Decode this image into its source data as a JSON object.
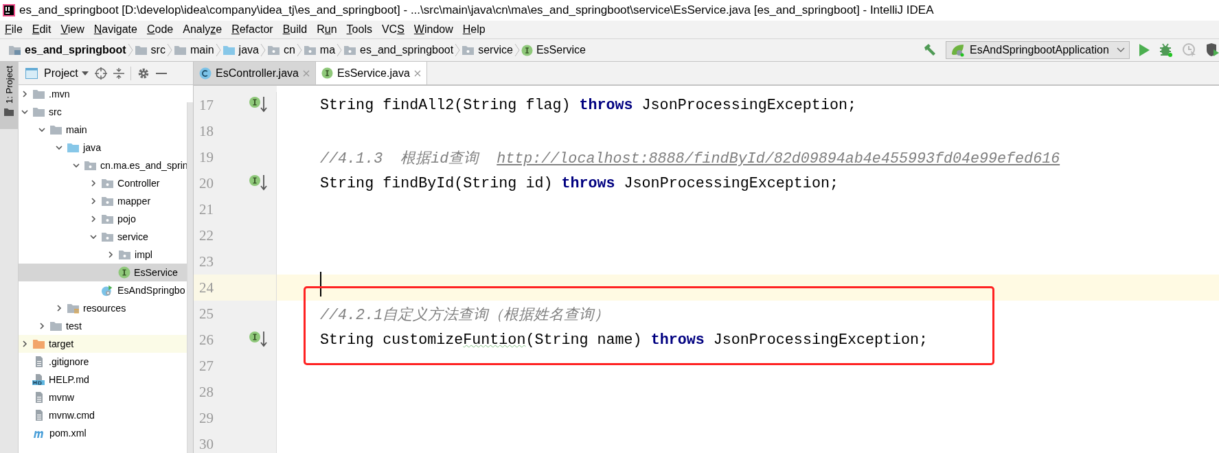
{
  "window": {
    "title": "es_and_springboot [D:\\develop\\idea\\company\\idea_tj\\es_and_springboot] - ...\\src\\main\\java\\cn\\ma\\es_and_springboot\\service\\EsService.java [es_and_springboot] - IntelliJ IDEA"
  },
  "menu": [
    {
      "key": "F",
      "after": "ile"
    },
    {
      "key": "E",
      "after": "dit"
    },
    {
      "key": "V",
      "after": "iew"
    },
    {
      "key": "N",
      "after": "avigate"
    },
    {
      "key": "C",
      "after": "ode"
    },
    {
      "before": "Analy",
      "key": "z",
      "after": "e"
    },
    {
      "key": "R",
      "after": "efactor"
    },
    {
      "key": "B",
      "after": "uild"
    },
    {
      "before": "R",
      "key": "u",
      "after": "n"
    },
    {
      "key": "T",
      "after": "ools"
    },
    {
      "before": "VC",
      "key": "S"
    },
    {
      "key": "W",
      "after": "indow"
    },
    {
      "key": "H",
      "after": "elp"
    }
  ],
  "breadcrumb": [
    {
      "label": "es_and_springboot",
      "kind": "project"
    },
    {
      "label": "src",
      "kind": "folder"
    },
    {
      "label": "main",
      "kind": "folder"
    },
    {
      "label": "java",
      "kind": "source"
    },
    {
      "label": "cn",
      "kind": "package"
    },
    {
      "label": "ma",
      "kind": "package"
    },
    {
      "label": "es_and_springboot",
      "kind": "package"
    },
    {
      "label": "service",
      "kind": "package"
    },
    {
      "label": "EsService",
      "kind": "interface"
    }
  ],
  "run_config": {
    "label": "EsAndSpringbootApplication"
  },
  "side_stripe": {
    "label": "1: Project",
    "selected": true
  },
  "project_panel": {
    "title": "Project",
    "tree": [
      {
        "label": ".mvn",
        "kind": "folder",
        "expanded": false
      },
      {
        "label": "src",
        "kind": "folder",
        "expanded": true,
        "children": [
          {
            "label": "main",
            "kind": "folder",
            "expanded": true,
            "children": [
              {
                "label": "java",
                "kind": "source",
                "expanded": true,
                "children": [
                  {
                    "label": "cn.ma.es_and_sprin",
                    "kind": "package",
                    "expanded": true,
                    "children": [
                      {
                        "label": "Controller",
                        "kind": "package",
                        "expanded": false
                      },
                      {
                        "label": "mapper",
                        "kind": "package",
                        "expanded": false
                      },
                      {
                        "label": "pojo",
                        "kind": "package",
                        "expanded": false
                      },
                      {
                        "label": "service",
                        "kind": "package",
                        "expanded": true,
                        "children": [
                          {
                            "label": "impl",
                            "kind": "package",
                            "expanded": false
                          },
                          {
                            "label": "EsService",
                            "kind": "interface",
                            "selected": true
                          }
                        ]
                      },
                      {
                        "label": "EsAndSpringbo",
                        "kind": "spring",
                        "selected": false
                      }
                    ]
                  }
                ]
              },
              {
                "label": "resources",
                "kind": "resources",
                "expanded": false
              }
            ]
          },
          {
            "label": "test",
            "kind": "folder",
            "expanded": false
          }
        ]
      },
      {
        "label": "target",
        "kind": "excluded",
        "expanded": false
      },
      {
        "label": ".gitignore",
        "kind": "file",
        "selected": false
      },
      {
        "label": "HELP.md",
        "kind": "markdown",
        "selected": false
      },
      {
        "label": "mvnw",
        "kind": "file",
        "selected": false
      },
      {
        "label": "mvnw.cmd",
        "kind": "file",
        "selected": false
      },
      {
        "label": "pom.xml",
        "kind": "maven",
        "selected": false
      }
    ]
  },
  "tabs": [
    {
      "label": "EsController.java",
      "kind": "class",
      "selected": false
    },
    {
      "label": "EsService.java",
      "kind": "interface",
      "selected": true
    }
  ],
  "editor": {
    "blocks": [
      {
        "boxed": false,
        "lines": [
          {
            "number": "17",
            "implemented": true,
            "current": false,
            "segments": [
              {
                "kind": "plain",
                "text": "    String findAll2(String flag) "
              },
              {
                "kind": "keyword",
                "text": "throws"
              },
              {
                "kind": "plain",
                "text": " JsonProcessingException;"
              }
            ]
          },
          {
            "number": "18",
            "current": false
          },
          {
            "number": "19",
            "current": false,
            "segments": [
              {
                "kind": "comment",
                "text": "    //4.1.3  根据id查询  "
              },
              {
                "kind": "link",
                "text": "http://localhost:8888/findById/82d09894ab4e455993fd04e99efed616"
              }
            ]
          },
          {
            "number": "20",
            "implemented": true,
            "current": false,
            "segments": [
              {
                "kind": "plain",
                "text": "    String findById(String id) "
              },
              {
                "kind": "keyword",
                "text": "throws"
              },
              {
                "kind": "plain",
                "text": " JsonProcessingException;"
              }
            ]
          },
          {
            "number": "21",
            "current": false
          },
          {
            "number": "22",
            "current": false
          },
          {
            "number": "23",
            "current": false
          },
          {
            "number": "24",
            "current": true
          }
        ]
      },
      {
        "boxed": true,
        "lines": [
          {
            "number": "25",
            "current": false,
            "segments": [
              {
                "kind": "comment",
                "text": "    //4.2.1自定义方法查询（根据姓名查询）"
              }
            ]
          },
          {
            "number": "26",
            "implemented": true,
            "current": false,
            "segments": [
              {
                "kind": "plain",
                "text": "    String customize"
              },
              {
                "kind": "typo",
                "text": "Funtion"
              },
              {
                "kind": "plain",
                "text": "(String name) "
              },
              {
                "kind": "keyword",
                "text": "throws"
              },
              {
                "kind": "plain",
                "text": " JsonProcessingException;"
              }
            ]
          }
        ]
      },
      {
        "boxed": false,
        "lines": [
          {
            "number": "27",
            "current": false
          },
          {
            "number": "28",
            "current": false
          },
          {
            "number": "29",
            "current": false
          },
          {
            "number": "30",
            "current": false
          }
        ]
      }
    ]
  }
}
